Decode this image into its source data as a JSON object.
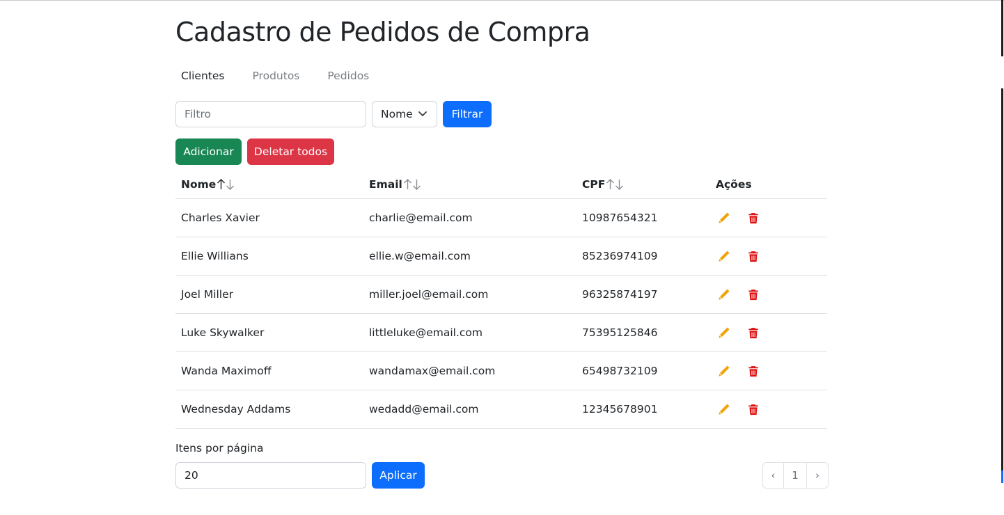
{
  "page": {
    "title": "Cadastro de Pedidos de Compra"
  },
  "tabs": [
    {
      "label": "Clientes",
      "active": true
    },
    {
      "label": "Produtos",
      "active": false
    },
    {
      "label": "Pedidos",
      "active": false
    }
  ],
  "filter": {
    "input_value": "",
    "input_placeholder": "Filtro",
    "select_value": "Nome",
    "button_label": "Filtrar"
  },
  "actions": {
    "add_label": "Adicionar",
    "delete_all_label": "Deletar todos"
  },
  "table": {
    "columns": [
      "Nome",
      "Email",
      "CPF",
      "Ações"
    ],
    "rows": [
      {
        "nome": "Charles Xavier",
        "email": "charlie@email.com",
        "cpf": "10987654321"
      },
      {
        "nome": "Ellie Willians",
        "email": "ellie.w@email.com",
        "cpf": "85236974109"
      },
      {
        "nome": "Joel Miller",
        "email": "miller.joel@email.com",
        "cpf": "96325874197"
      },
      {
        "nome": "Luke Skywalker",
        "email": "littleluke@email.com",
        "cpf": "75395125846"
      },
      {
        "nome": "Wanda Maximoff",
        "email": "wandamax@email.com",
        "cpf": "65498732109"
      },
      {
        "nome": "Wednesday Addams",
        "email": "wedadd@email.com",
        "cpf": "12345678901"
      }
    ],
    "row_icons": {
      "edit": "pencil-icon",
      "delete": "trash-icon"
    }
  },
  "pagination": {
    "items_per_page_label": "Itens por página",
    "items_per_page_value": "20",
    "apply_label": "Aplicar",
    "prev": "‹",
    "current_page": "1",
    "next": "›"
  },
  "colors": {
    "primary": "#0d6efd",
    "success": "#198754",
    "danger": "#dc3545",
    "edit_icon": "#f0a30a",
    "delete_icon": "#dd1111",
    "text": "#212529"
  }
}
